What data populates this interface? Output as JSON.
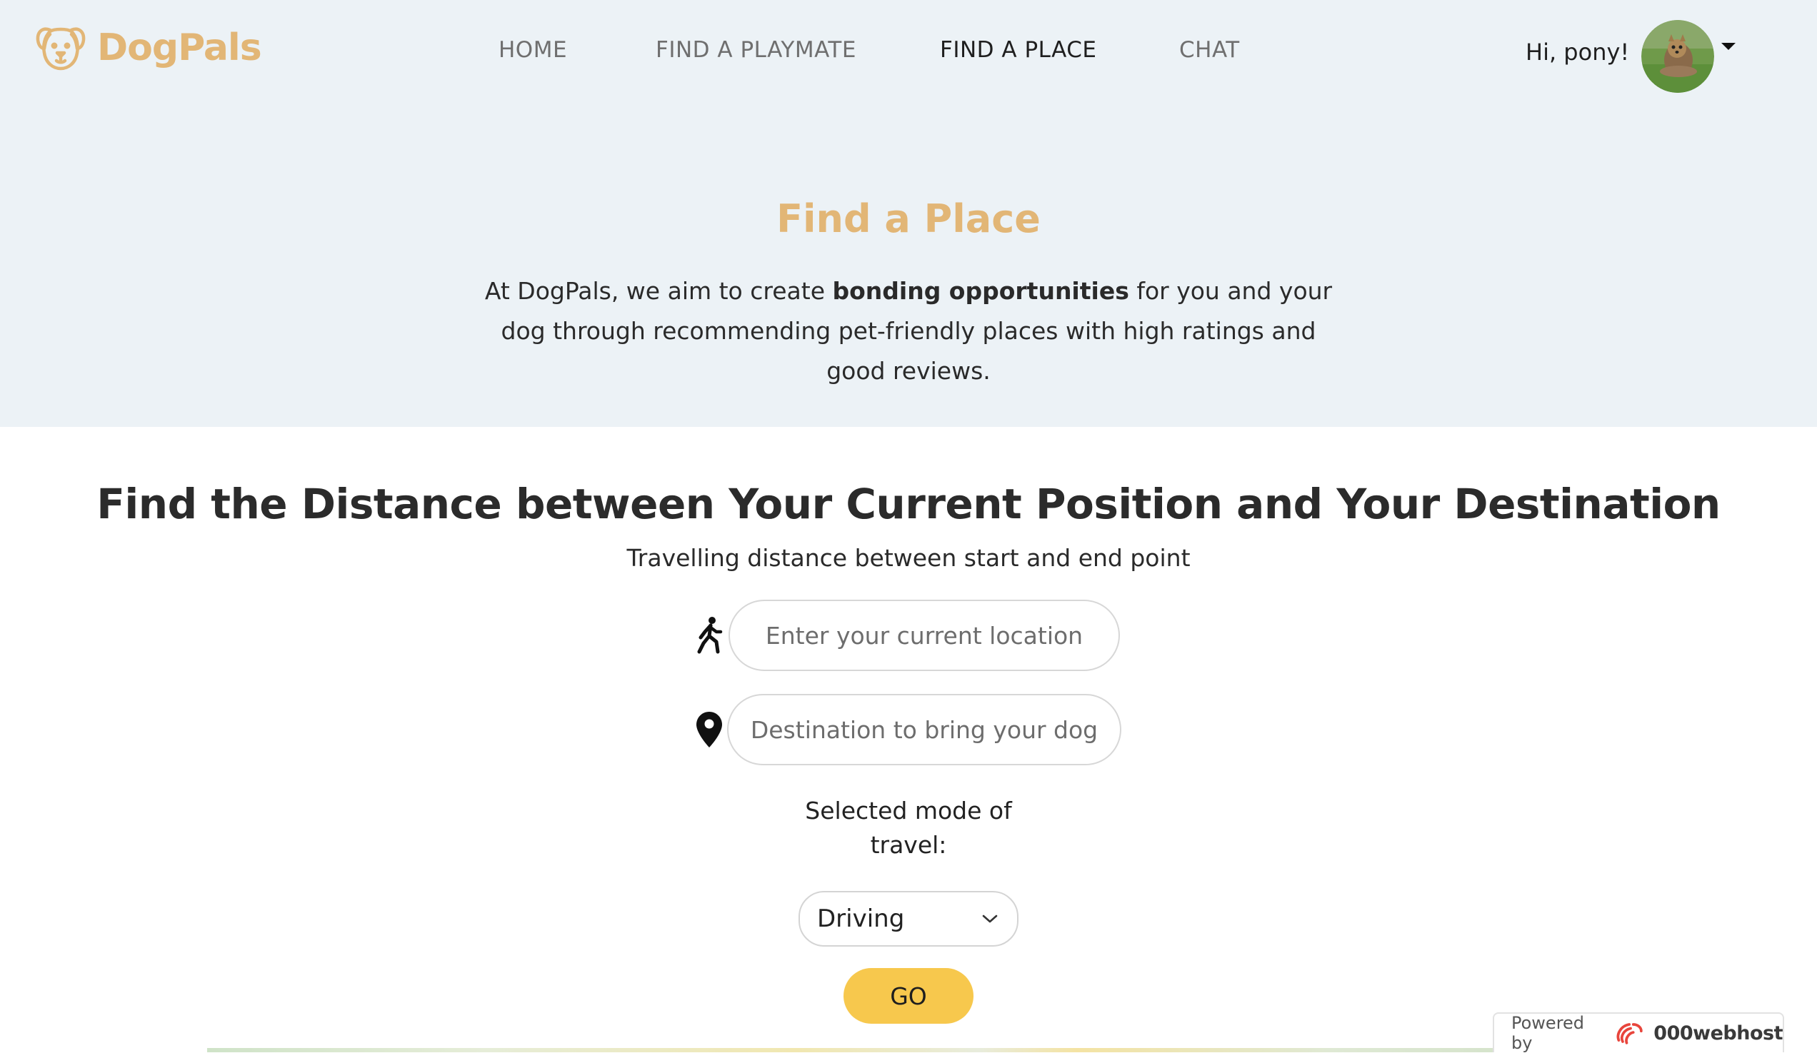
{
  "brand": {
    "name": "DogPals",
    "color": "#e2b676"
  },
  "nav": {
    "items": [
      {
        "label": "HOME",
        "active": false
      },
      {
        "label": "FIND A PLAYMATE",
        "active": false
      },
      {
        "label": "FIND A PLACE",
        "active": true
      },
      {
        "label": "CHAT",
        "active": false
      }
    ]
  },
  "user": {
    "greeting": "Hi, pony!",
    "avatar_icon": "dog-avatar"
  },
  "hero": {
    "title": "Find a Place",
    "desc_prefix": "At DogPals, we aim to create ",
    "desc_bold": "bonding opportunities",
    "desc_suffix": " for you and your dog through recommending pet-friendly places with high ratings and good reviews."
  },
  "distance": {
    "title": "Find the Distance between Your Current Position and Your Destination",
    "subtitle": "Travelling distance between start and end point",
    "start_icon": "walking-person-icon",
    "start_placeholder": "Enter your current location",
    "start_value": "",
    "dest_icon": "map-pin-icon",
    "dest_placeholder": "Destination to bring your dog",
    "dest_value": "",
    "mode_label": "Selected mode of travel:",
    "mode_selected": "Driving",
    "go_label": "GO"
  },
  "footer_badge": {
    "powered_text": "Powered by",
    "host_name": "000webhost"
  },
  "colors": {
    "hero_bg": "#ecf2f6",
    "button_yellow": "#f7c84d"
  }
}
